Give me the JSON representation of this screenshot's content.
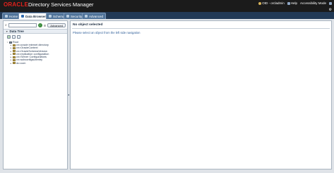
{
  "header": {
    "logo": "ORACLE",
    "title": "Directory Services Manager",
    "connection": "OID - orcladmin",
    "help": "Help",
    "accessibility": "Accessibility Mode",
    "settings_glyph": "⚙"
  },
  "tabs": [
    {
      "label": "Home",
      "icon": "home-icon",
      "active": false
    },
    {
      "label": "Data Browser",
      "icon": "data-browser-icon",
      "active": true
    },
    {
      "label": "Schema",
      "icon": "schema-icon",
      "active": false
    },
    {
      "label": "Security",
      "icon": "security-icon",
      "active": false
    },
    {
      "label": "Advanced",
      "icon": "advanced-icon",
      "active": false
    }
  ],
  "search": {
    "value": "",
    "advanced_label": "Advanced"
  },
  "data_tree": {
    "title": "Data Tree",
    "root": "Root",
    "children": [
      "cn=oracle internet directory",
      "cn=OracleContext",
      "cn=OracleSchemaVersion",
      "cn=replication configuration",
      "cn=Server Configurations",
      "cn=subconfigsubentry",
      "dc=com"
    ]
  },
  "detail": {
    "title": "No object selected",
    "message": "Please select an object from the left side navigation"
  },
  "colors": {
    "header_bg": "#1b1b1b",
    "oracle_red": "#e2211c",
    "tabbar_bg": "#223a56",
    "link_blue": "#2d5d98"
  }
}
